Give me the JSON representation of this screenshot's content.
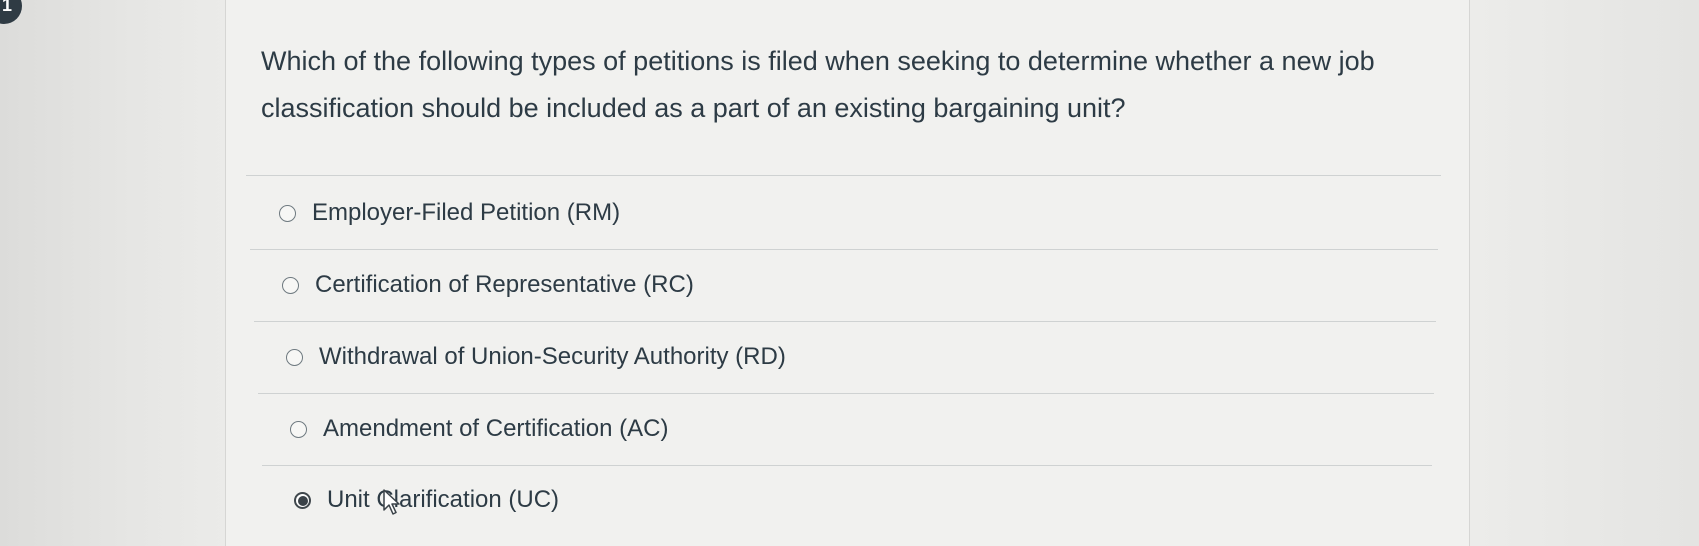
{
  "question": {
    "number": "1",
    "text": "Which of the following types of petitions is filed when seeking to determine whether a new job classification should be included as a part of an existing bargaining unit?"
  },
  "options": [
    {
      "label": "Employer-Filed Petition (RM)",
      "selected": false
    },
    {
      "label": "Certification of Representative (RC)",
      "selected": false
    },
    {
      "label": "Withdrawal of Union-Security Authority (RD)",
      "selected": false
    },
    {
      "label": "Amendment of Certification (AC)",
      "selected": false
    },
    {
      "label": "Unit Clarification (UC)",
      "selected": true
    }
  ],
  "colors": {
    "text": "#2d3b45",
    "card": "#f1f1ef",
    "background": "#e8e8e6"
  },
  "icons": [
    "radio-button-icon",
    "mouse-pointer-icon"
  ]
}
